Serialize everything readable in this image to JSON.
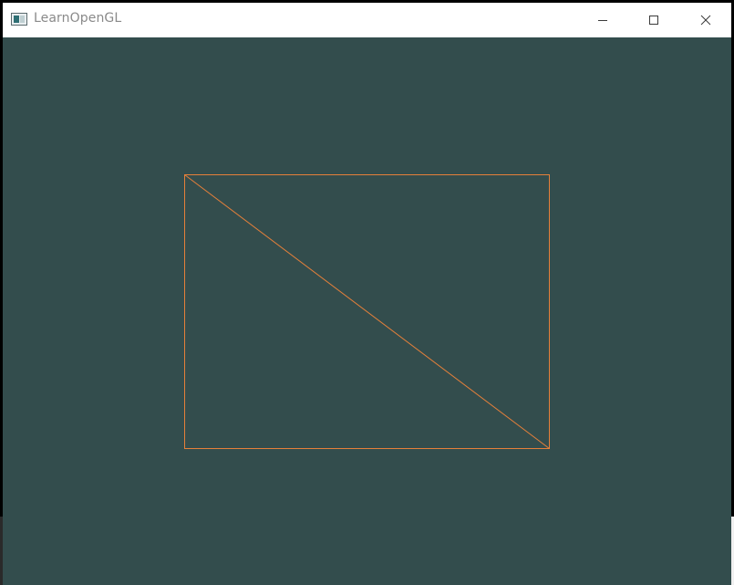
{
  "window": {
    "title": "LearnOpenGL",
    "icon": "app-window-icon",
    "controls": {
      "minimize_icon": "minimize-icon",
      "maximize_icon": "maximize-icon",
      "close_icon": "close-icon"
    }
  },
  "viewport": {
    "clear_color": "#334d4d",
    "line_color": "#e6803a",
    "render_mode": "wireframe",
    "shape": "rectangle made of two triangles with a diagonal"
  }
}
